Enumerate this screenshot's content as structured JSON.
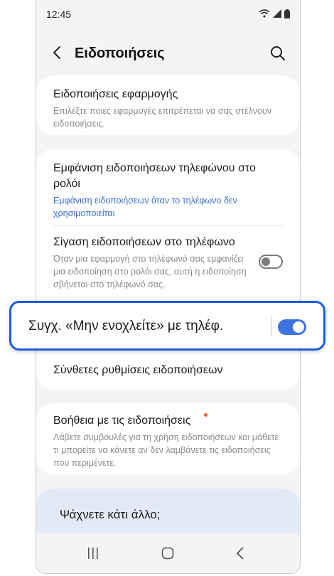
{
  "status_bar": {
    "time": "12:45"
  },
  "header": {
    "title": "Ειδοποιήσεις"
  },
  "sections": [
    {
      "title": "Ειδοποιήσεις εφαρμογής",
      "subtitle": "Επιλέξτε ποιες εφαρμογές επιτρέπεται να σας στέλνουν ειδοποιήσεις."
    },
    {
      "title": "Εμφάνιση ειδοποιήσεων τηλεφώνου στο ρολόι",
      "subtitle": "Εμφάνιση ειδοποιήσεων όταν το τηλέφωνο δεν χρησιμοποιείται"
    },
    {
      "title": "Σίγαση ειδοποιήσεων στο τηλέφωνο",
      "subtitle": "Όταν μια εφαρμογή στο τηλέφωνό σας εμφανίζει μια ειδοποίηση στο ρολόι σας, αυτή η ειδοποίηση σβήνεται στο τηλέφωνό σας.",
      "toggle_state": "off"
    },
    {
      "title": "Συγχ. «Μην ενοχλείτε» με τηλέφ.",
      "toggle_state": "on"
    },
    {
      "title": "Σύνθετες ρυθμίσεις ειδοποιήσεων"
    },
    {
      "title": "Βοήθεια με τις ειδοποιήσεις",
      "subtitle": "Λάβετε συμβουλές για τη χρήση ειδοποιήσεων και μάθετε τι μπορείτε να κάνετε αν δεν λαμβάνετε τις ειδοποιήσεις που περιμένετε."
    }
  ],
  "help_card": {
    "title": "Ψάχνετε κάτι άλλο;"
  },
  "colors": {
    "accent": "#3e74e0",
    "highlight_border": "#1b5cd6",
    "link": "#3b6fd1",
    "badge": "#f05a23"
  },
  "icons": {
    "back": "chevron-left-icon",
    "search": "search-icon",
    "wifi": "wifi-icon",
    "signal": "signal-icon",
    "battery": "battery-icon",
    "recents": "recents-icon",
    "home": "home-icon",
    "nav_back": "nav-back-icon"
  }
}
